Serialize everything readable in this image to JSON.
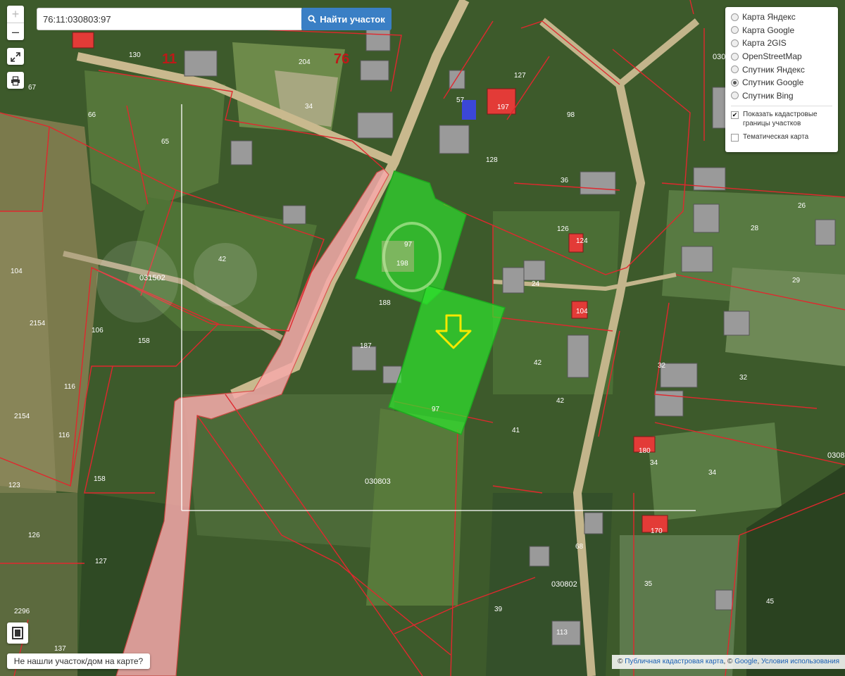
{
  "search": {
    "value": "76:11:030803:97",
    "button_label": "Найти участок",
    "button_icon": "search-icon"
  },
  "map_controls": {
    "zoom_in": "+",
    "zoom_out": "–",
    "fullscreen_icon": "expand-icon",
    "print_icon": "printer-icon",
    "legend_icon": "book-icon"
  },
  "layers": {
    "base_options": [
      {
        "label": "Карта Яндекс",
        "selected": false
      },
      {
        "label": "Карта Google",
        "selected": false
      },
      {
        "label": "Карта 2GIS",
        "selected": false
      },
      {
        "label": "OpenStreetMap",
        "selected": false
      },
      {
        "label": "Спутник Яндекс",
        "selected": false
      },
      {
        "label": "Спутник Google",
        "selected": true
      },
      {
        "label": "Спутник Bing",
        "selected": false
      }
    ],
    "overlays": [
      {
        "label": "Показать кадастровые границы участков",
        "checked": true
      },
      {
        "label": "Тематическая карта",
        "checked": false
      }
    ]
  },
  "not_found_button": "Не нашли участок/дом на карте?",
  "attribution": {
    "cadastral_link": "Публичная кадастровая карта",
    "separator": ", ©",
    "google_link": "Google",
    "comma": ",",
    "terms_link": "Условия использования",
    "prefix": "©"
  },
  "map_labels": {
    "quarter_big_11": "11",
    "quarter_big_76": "76",
    "quarters": [
      "030802",
      "031502",
      "030803",
      "030802",
      "03080"
    ],
    "parcels": [
      "130",
      "204",
      "67",
      "66",
      "65",
      "34",
      "57",
      "127",
      "197",
      "98",
      "128",
      "36",
      "26",
      "28",
      "126",
      "124",
      "24",
      "29",
      "42",
      "188",
      "187",
      "158",
      "106",
      "2154",
      "97",
      "116",
      "2154",
      "116",
      "158",
      "104",
      "123",
      "126",
      "127",
      "2296",
      "137",
      "42",
      "32",
      "32",
      "41",
      "42",
      "34",
      "34",
      "35",
      "45",
      "68",
      "39",
      "113",
      "180",
      "170",
      "104"
    ],
    "highlight_parcel": "97",
    "highlight_house": "198"
  },
  "colors": {
    "parcel_highlight": "#2ee62e",
    "cadastral_boundary": "#e0282e",
    "road_overlay": "#f5a9a9",
    "target_arrow": "#f5e800",
    "search_button": "#3a7fc5"
  }
}
